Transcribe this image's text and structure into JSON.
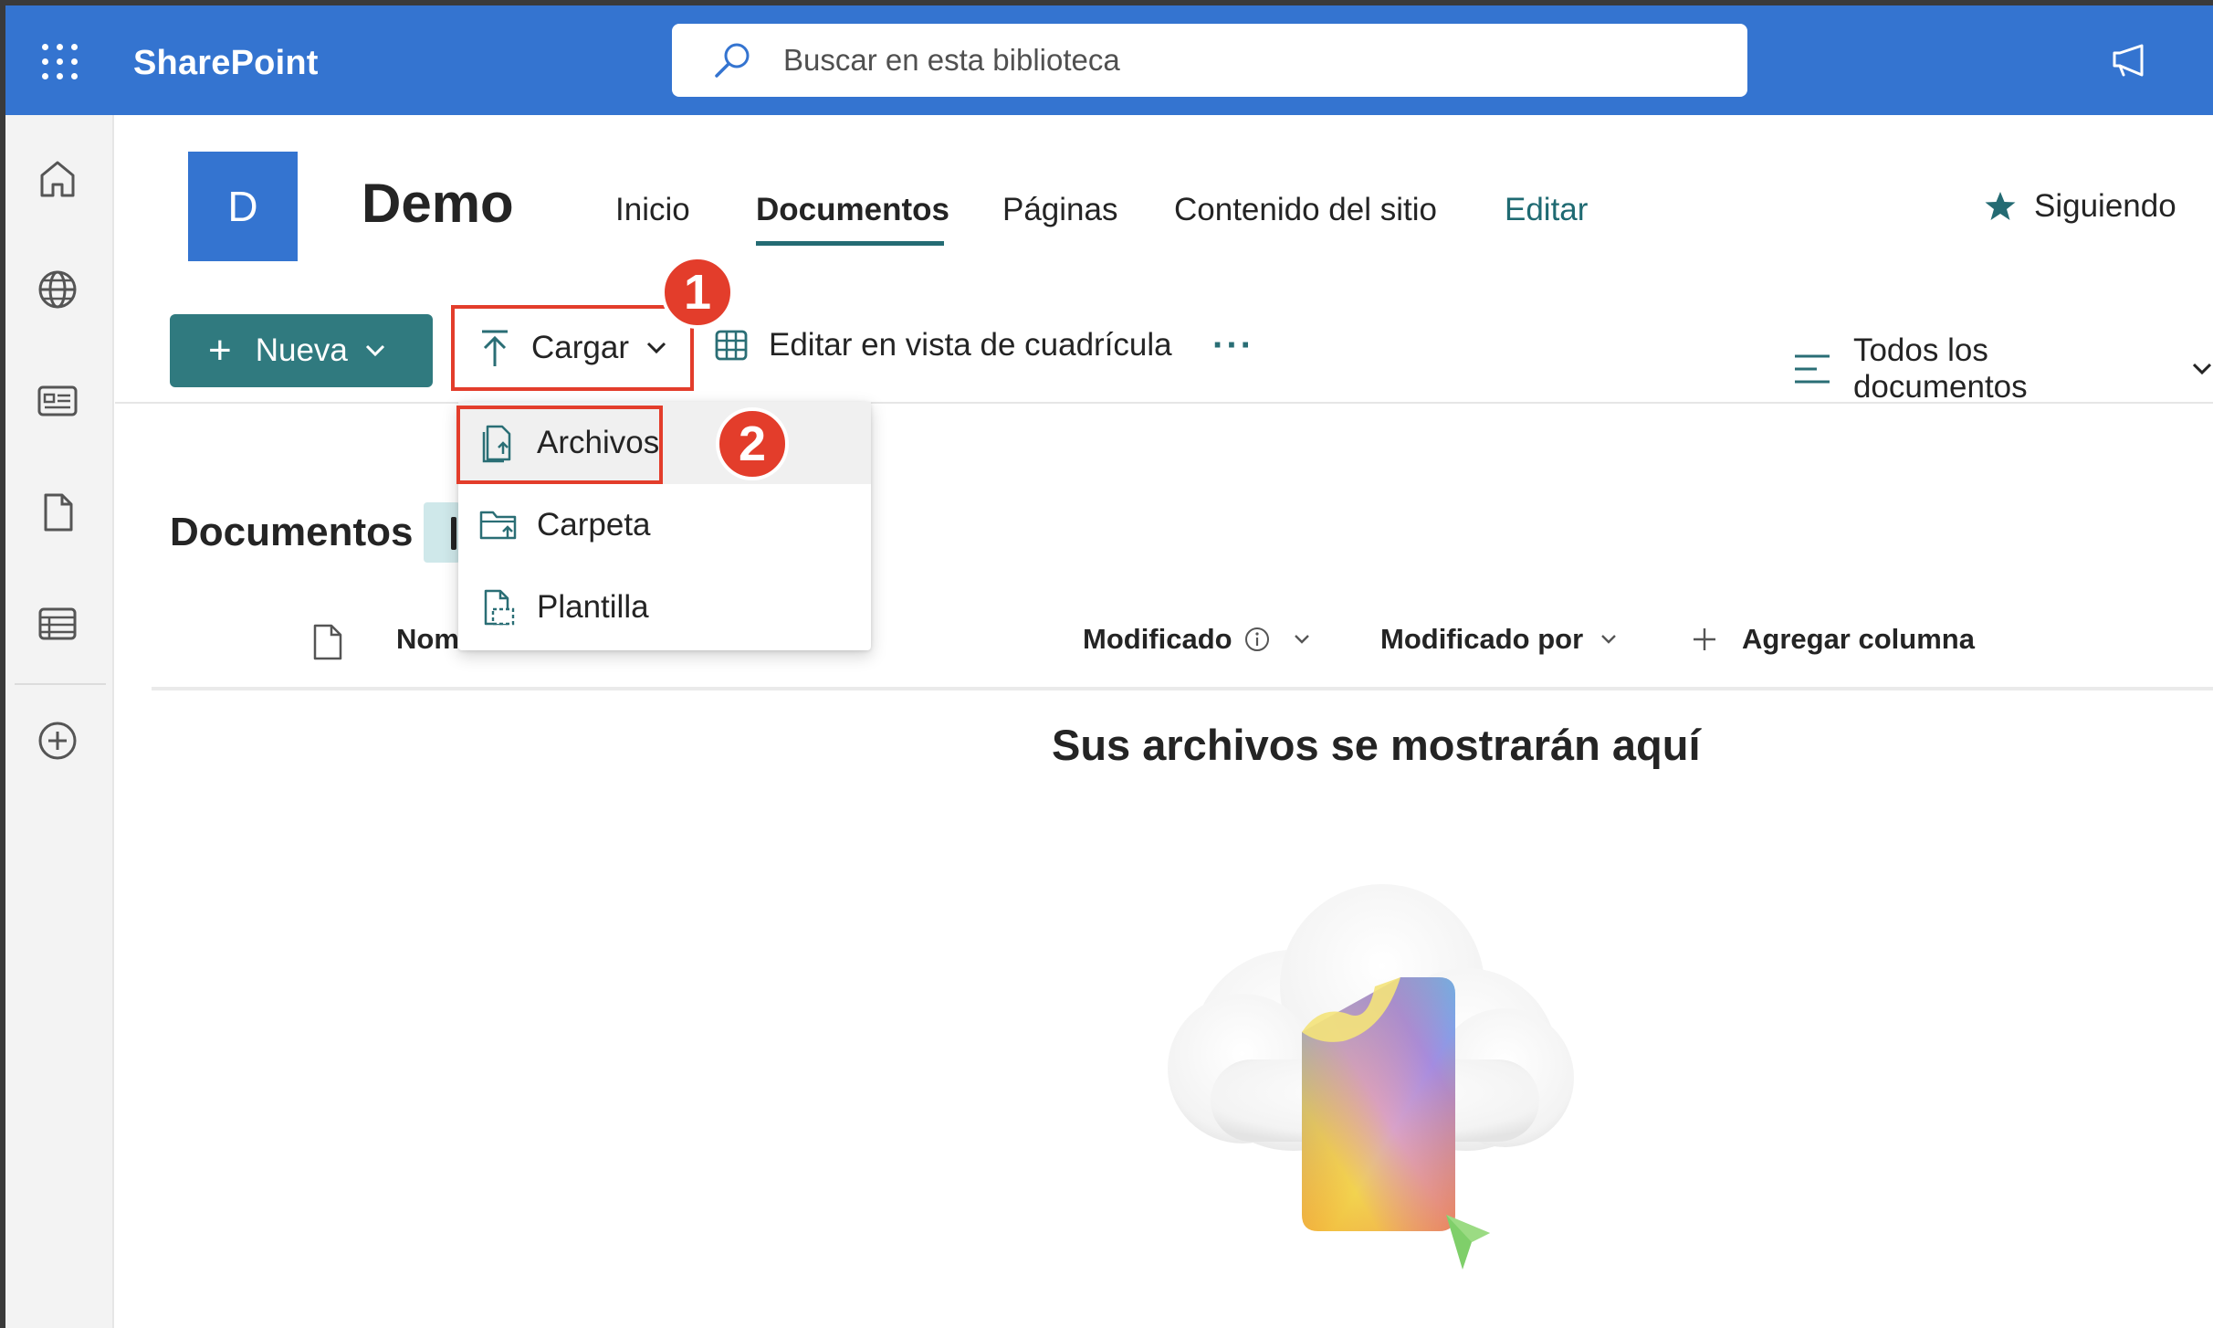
{
  "app": {
    "name": "SharePoint"
  },
  "search": {
    "placeholder": "Buscar en esta biblioteca"
  },
  "site": {
    "logo_letter": "D",
    "title": "Demo",
    "nav": [
      {
        "label": "Inicio"
      },
      {
        "label": "Documentos",
        "active": true
      },
      {
        "label": "Páginas"
      },
      {
        "label": "Contenido del sitio"
      },
      {
        "label": "Editar"
      }
    ],
    "follow_label": "Siguiendo"
  },
  "commandbar": {
    "new_label": "Nueva",
    "upload_label": "Cargar",
    "grid_label": "Editar en vista de cuadrícula",
    "more_label": "···",
    "view_label": "Todos los documentos"
  },
  "upload_menu": {
    "items": [
      {
        "label": "Archivos",
        "icon": "file-upload-icon",
        "highlighted": true
      },
      {
        "label": "Carpeta",
        "icon": "folder-upload-icon"
      },
      {
        "label": "Plantilla",
        "icon": "template-icon"
      }
    ]
  },
  "annotations": {
    "step1": "1",
    "step2": "2",
    "highlight_color": "#e33d2b"
  },
  "library": {
    "title": "Documentos",
    "columns": {
      "name": "Nom",
      "modified": "Modificado",
      "modified_by": "Modificado por",
      "add_column": "Agregar columna"
    },
    "empty_message": "Sus archivos se mostrarán aquí"
  },
  "colors": {
    "suite_bar": "#3474d0",
    "accent_teal": "#307a7f"
  }
}
